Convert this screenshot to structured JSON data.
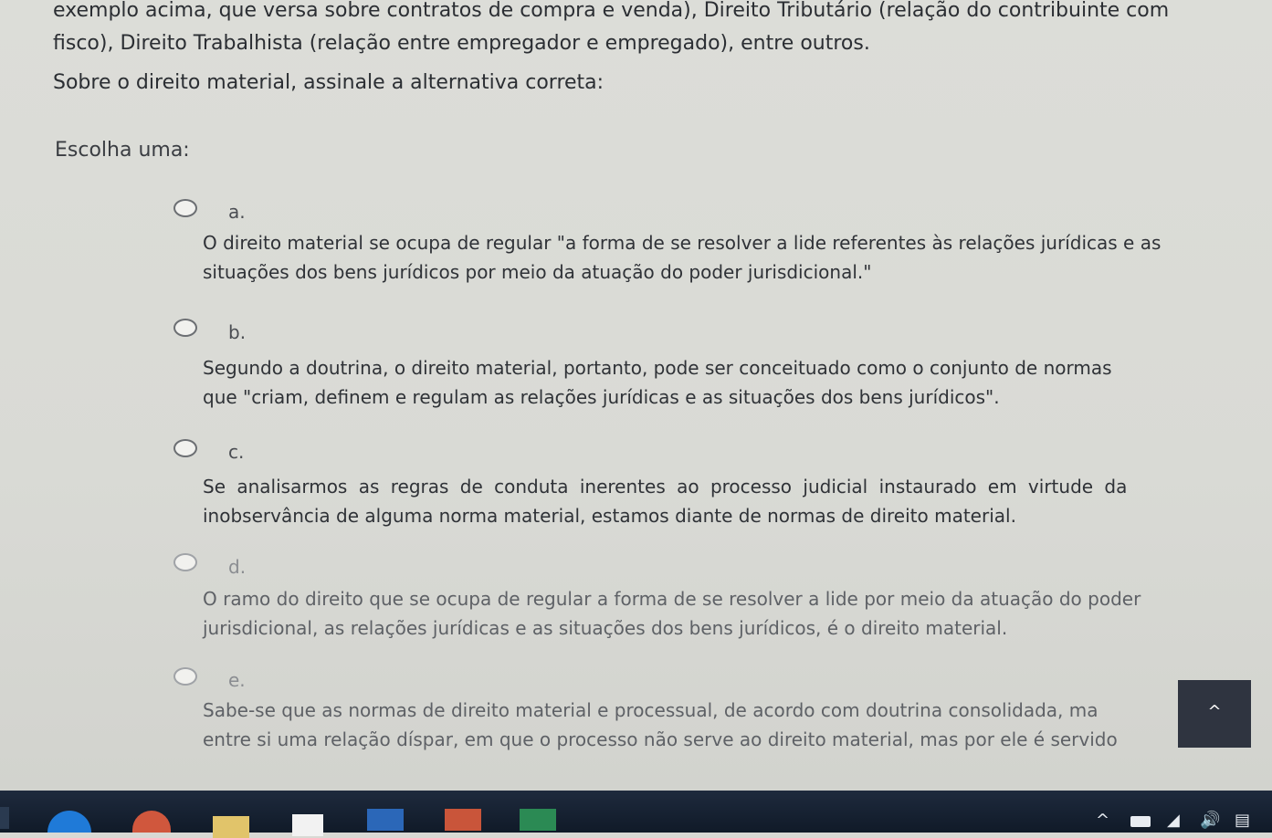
{
  "intro": {
    "line1": "exemplo acima, que versa sobre contratos de compra e venda), Direito Tributário (relação do contribuinte com",
    "line2": "fisco), Direito Trabalhista (relação entre empregador e empregado), entre outros."
  },
  "question": "Sobre o direito material, assinale a alternativa correta:",
  "choose_label": "Escolha uma:",
  "options": [
    {
      "letter": "a.",
      "line1": "O direito material se ocupa de regular \"a forma de se resolver a lide referentes às relações jurídicas e as",
      "line2": "situações dos bens jurídicos por meio da atuação do poder jurisdicional.\""
    },
    {
      "letter": "b.",
      "line1": "Segundo a doutrina, o direito material, portanto, pode ser conceituado como o conjunto de normas",
      "line2": "que \"criam, definem e regulam as relações jurídicas e as situações dos bens jurídicos\"."
    },
    {
      "letter": "c.",
      "line1": "Se analisarmos as regras de conduta inerentes ao processo judicial instaurado em virtude da",
      "line2": "inobservância de alguma norma material, estamos diante de normas de direito material."
    },
    {
      "letter": "d.",
      "line1": "O ramo do direito que se ocupa de regular a forma de se resolver a lide por meio da atuação do poder",
      "line2": "jurisdicional, as relações jurídicas e as situações dos bens jurídicos, é o direito material."
    },
    {
      "letter": "e.",
      "line1": "Sabe-se que as normas de direito material e processual, de acordo com doutrina consolidada, ma",
      "line2": "entre si uma relação díspar, em que o processo não serve ao direito material, mas por ele é servido"
    }
  ],
  "scroll_top_icon": "chevron-up-icon",
  "scroll_top_glyph": "^",
  "taskbar": {
    "tray_chevron": "^",
    "wifi_glyph": "◢",
    "volume_glyph": "🔊",
    "notification_glyph": "▤"
  },
  "colors": {
    "page_bg": "#d9dad5",
    "text": "#2b2e33",
    "scroll_button": "#2f3440",
    "taskbar": "#1a2435"
  }
}
